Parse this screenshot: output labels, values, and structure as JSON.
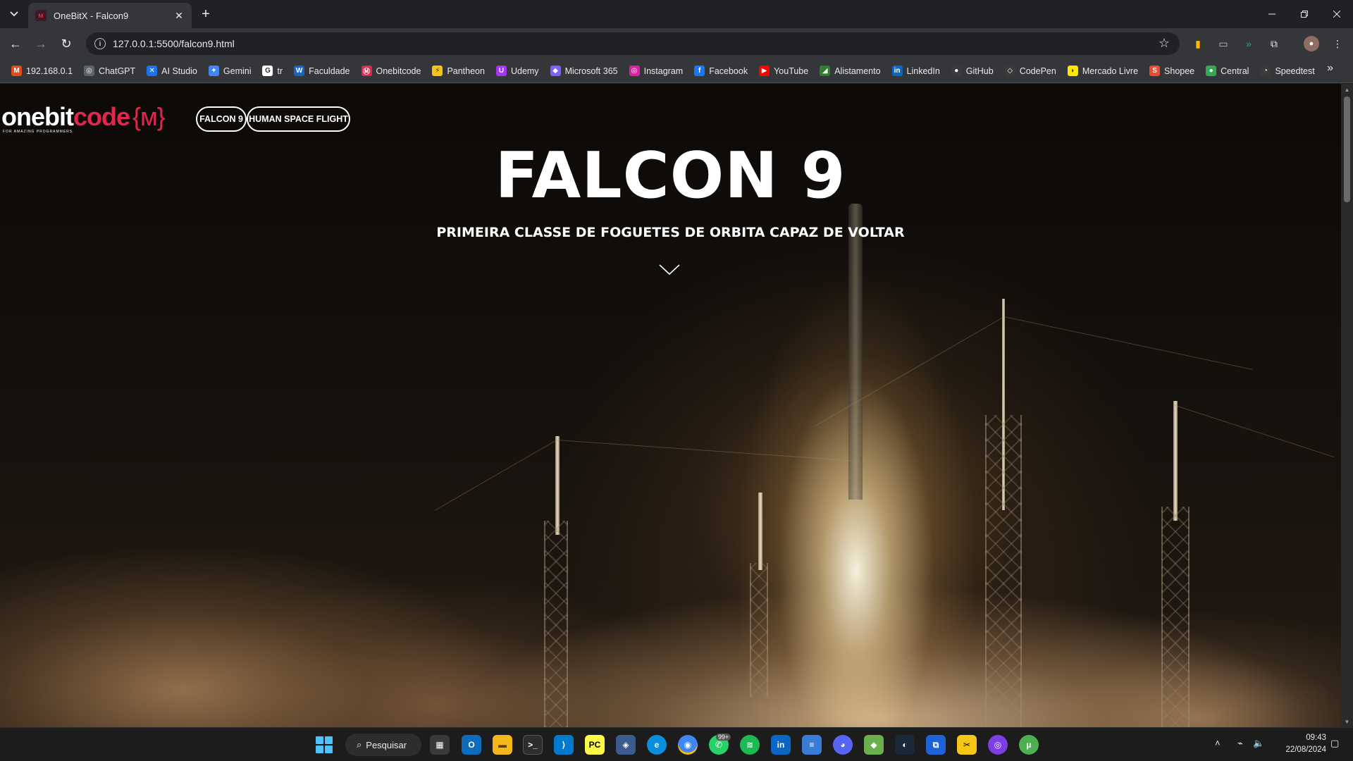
{
  "browser": {
    "tab_title": "OneBitX - Falcon9",
    "url": "127.0.0.1:5500/falcon9.html",
    "bookmarks": [
      {
        "label": "192.168.0.1",
        "icon": "router-icon",
        "color": "#e64a19",
        "glyph": "M"
      },
      {
        "label": "ChatGPT",
        "icon": "chatgpt-icon",
        "color": "#5f6368",
        "glyph": "◎"
      },
      {
        "label": "AI Studio",
        "icon": "ai-studio-icon",
        "color": "#1a73e8",
        "glyph": "✕"
      },
      {
        "label": "Gemini",
        "icon": "gemini-icon",
        "color": "#4285f4",
        "glyph": "✦"
      },
      {
        "label": "tr",
        "icon": "google-icon",
        "color": "#ffffff",
        "glyph": "G"
      },
      {
        "label": "Faculdade",
        "icon": "faculdade-icon",
        "color": "#1565c0",
        "glyph": "W"
      },
      {
        "label": "Onebitcode",
        "icon": "onebitcode-icon",
        "color": "#e2264d",
        "glyph": "Ⓜ"
      },
      {
        "label": "Pantheon",
        "icon": "pantheon-icon",
        "color": "#f5c518",
        "glyph": "⚡"
      },
      {
        "label": "Udemy",
        "icon": "udemy-icon",
        "color": "#a435f0",
        "glyph": "U"
      },
      {
        "label": "Microsoft 365",
        "icon": "microsoft365-icon",
        "color": "#7b61ff",
        "glyph": "◆"
      },
      {
        "label": "Instagram",
        "icon": "instagram-icon",
        "color": "#d6249f",
        "glyph": "◎"
      },
      {
        "label": "Facebook",
        "icon": "facebook-icon",
        "color": "#1877f2",
        "glyph": "f"
      },
      {
        "label": "YouTube",
        "icon": "youtube-icon",
        "color": "#ff0000",
        "glyph": "▶"
      },
      {
        "label": "Alistamento",
        "icon": "alistamento-icon",
        "color": "#2e7d32",
        "glyph": "◢"
      },
      {
        "label": "LinkedIn",
        "icon": "linkedin-icon",
        "color": "#0a66c2",
        "glyph": "in"
      },
      {
        "label": "GitHub",
        "icon": "github-icon",
        "color": "#3a3a3a",
        "glyph": "●"
      },
      {
        "label": "CodePen",
        "icon": "codepen-icon",
        "color": "#3a3a3a",
        "glyph": "◇"
      },
      {
        "label": "Mercado Livre",
        "icon": "mercado-livre-icon",
        "color": "#ffe600",
        "glyph": "◗"
      },
      {
        "label": "Shopee",
        "icon": "shopee-icon",
        "color": "#ee4d2d",
        "glyph": "S"
      },
      {
        "label": "Central",
        "icon": "central-icon",
        "color": "#34a853",
        "glyph": "●"
      },
      {
        "label": "Speedtest",
        "icon": "speedtest-icon",
        "color": "#3a3a3a",
        "glyph": "◔"
      }
    ]
  },
  "site": {
    "logo_white": "onebit",
    "logo_red": "code",
    "logo_brace": "{ᴍ}",
    "logo_tagline": "FOR AMAZING PROGRAMMERS",
    "nav": [
      "FALCON 9",
      "HUMAN SPACE FLIGHT"
    ],
    "hero_title": "FALCON 9",
    "hero_subtitle": "PRIMEIRA CLASSE DE FOGUETES DE ORBITA CAPAZ DE VOLTAR"
  },
  "taskbar": {
    "search_label": "Pesquisar",
    "whatsapp_badge": "99+",
    "time": "09:43",
    "date": "22/08/2024"
  }
}
